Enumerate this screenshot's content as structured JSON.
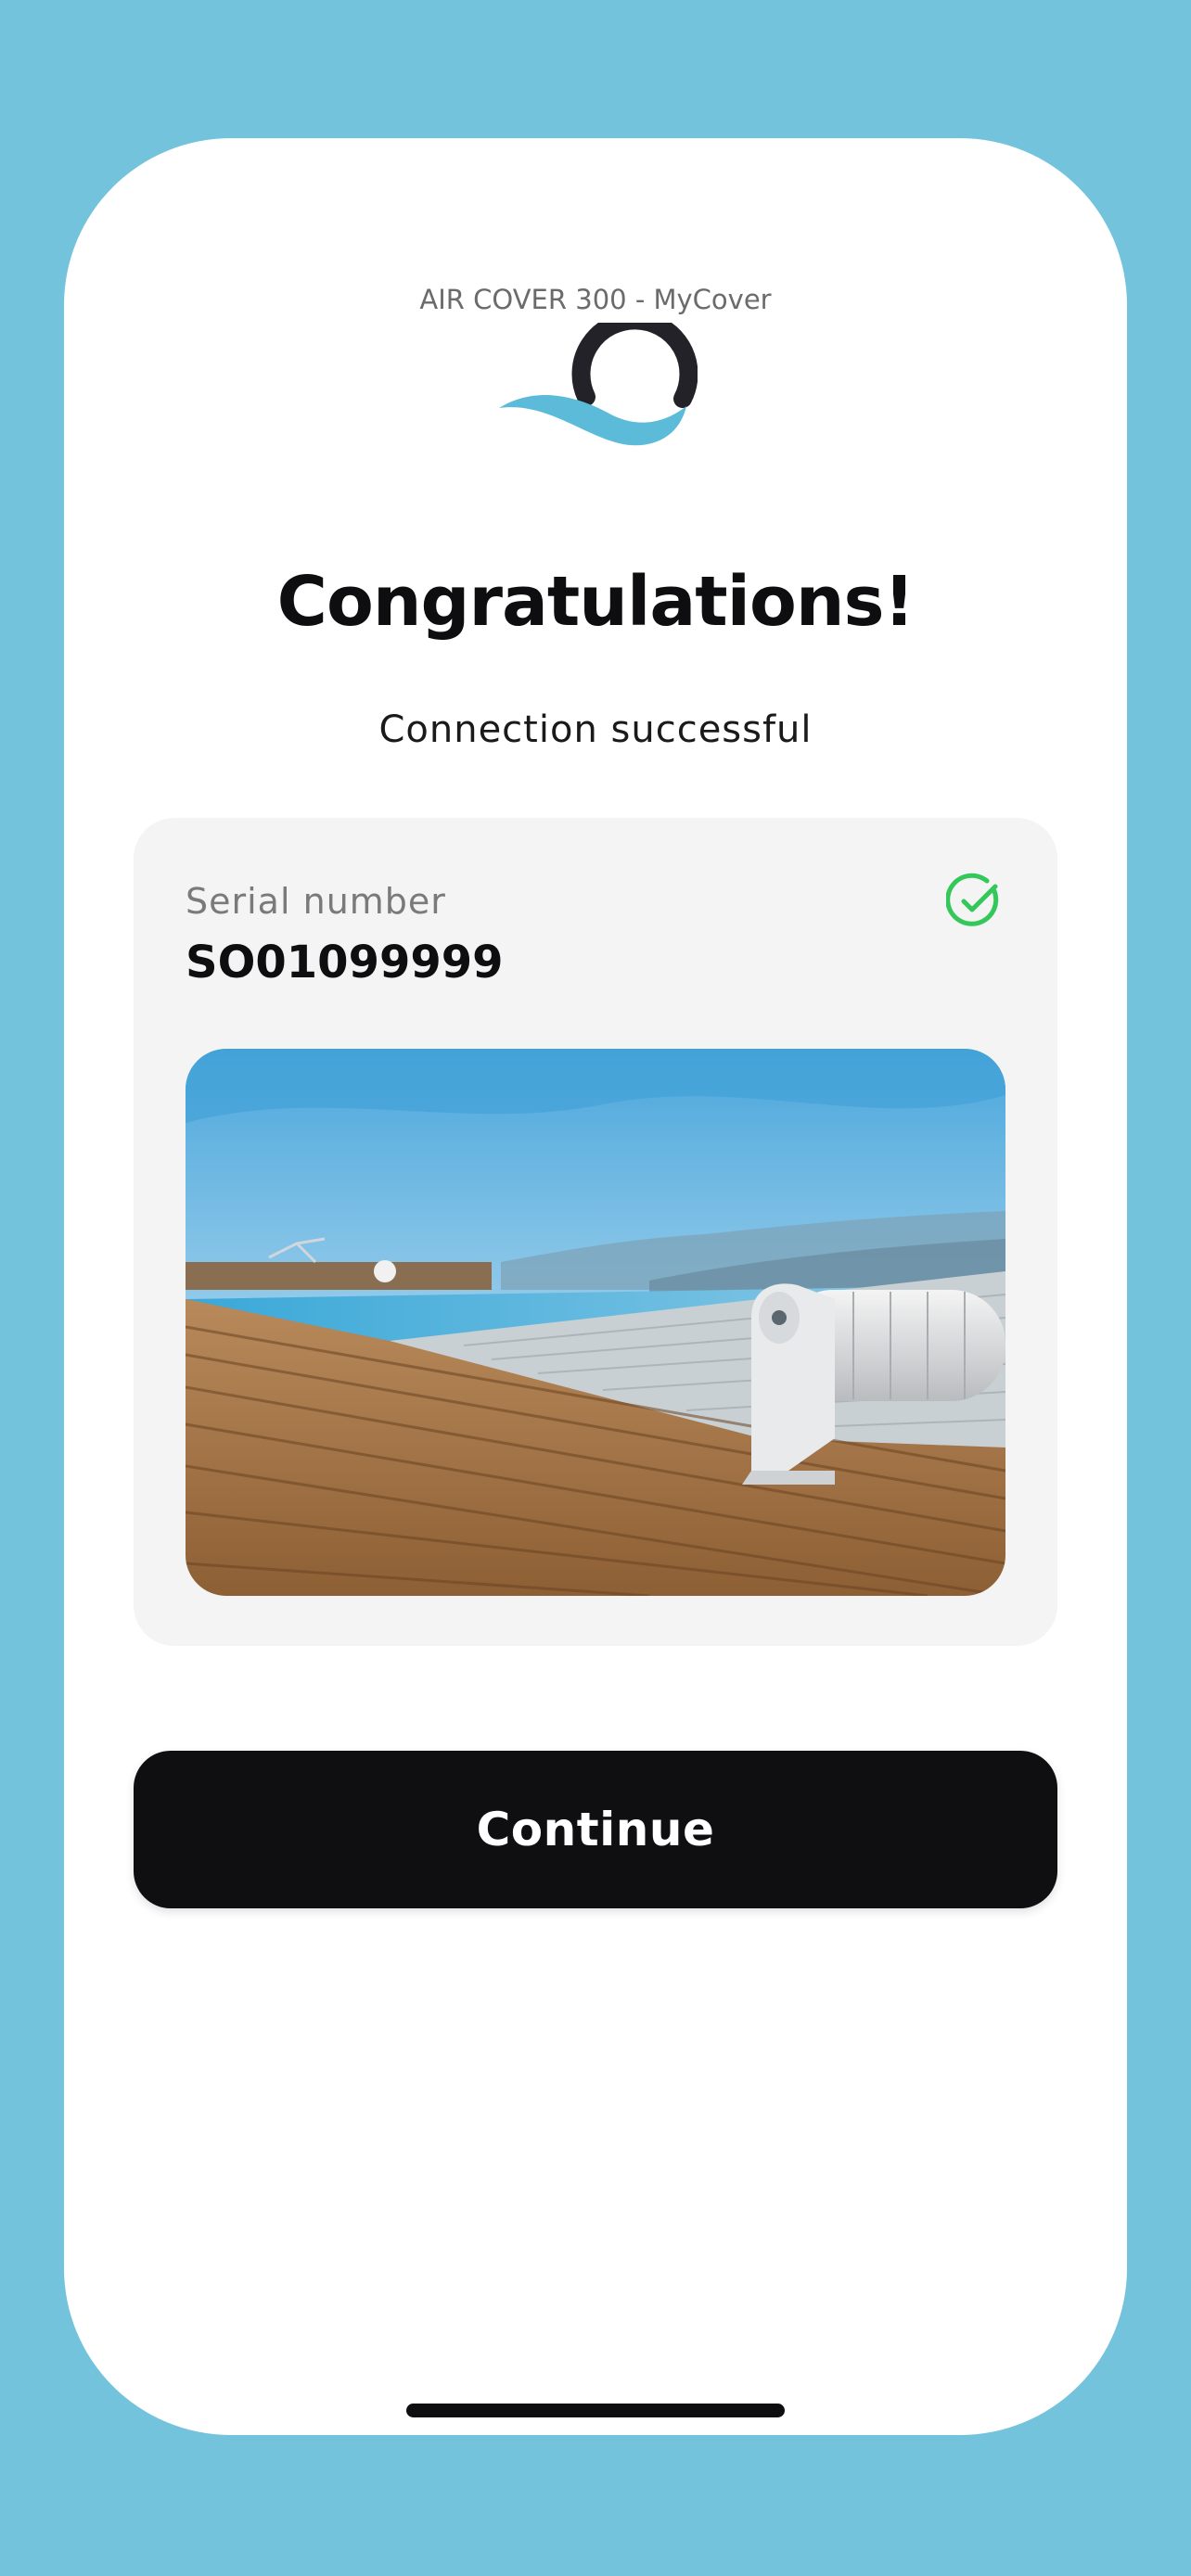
{
  "app": {
    "name": "AIR COVER 300 - MyCover",
    "logo_icon": "mycover-logo"
  },
  "status": {
    "title": "Congratulations!",
    "subtitle": "Connection successful"
  },
  "device_card": {
    "serial_label": "Serial number",
    "serial_value": "SO01099999",
    "verified_icon": "check-circle-icon",
    "verified_color": "#34c759",
    "image": "pool-cover-photo"
  },
  "actions": {
    "continue_label": "Continue"
  },
  "colors": {
    "background": "#74c3dd",
    "card": "#f4f4f4",
    "button": "#0f0f11",
    "logo_wave": "#5bbbd9",
    "logo_arc": "#222228"
  }
}
